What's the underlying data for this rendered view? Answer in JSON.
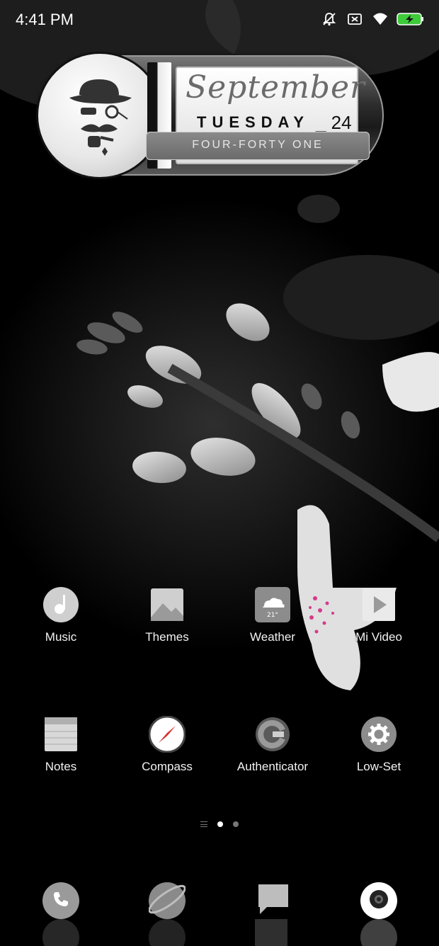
{
  "status_bar": {
    "time": "4:41 PM",
    "icons": [
      "mute-bell-icon",
      "sim-off-icon",
      "wifi-icon",
      "battery-charging-icon"
    ]
  },
  "widget": {
    "month": "September",
    "weekday": "TUESDAY",
    "date": "_ 24",
    "time_words": "FOUR-FORTY ONE"
  },
  "apps": [
    {
      "label": "Music",
      "icon": "music-icon"
    },
    {
      "label": "Themes",
      "icon": "themes-icon"
    },
    {
      "label": "Weather",
      "icon": "weather-icon",
      "badge": "21°"
    },
    {
      "label": "Mi Video",
      "icon": "play-icon"
    },
    {
      "label": "Notes",
      "icon": "notes-icon"
    },
    {
      "label": "Compass",
      "icon": "compass-icon"
    },
    {
      "label": "Authenticator",
      "icon": "authenticator-icon"
    },
    {
      "label": "Low-Set",
      "icon": "gear-icon"
    }
  ],
  "pager": {
    "pages": 2,
    "active": 0
  },
  "dock": [
    "phone-icon",
    "browser-icon",
    "messages-icon",
    "camera-icon"
  ],
  "colors": {
    "accent_pink": "#d43a8a",
    "battery_green": "#3ecb3a",
    "compass_red": "#e03030"
  }
}
